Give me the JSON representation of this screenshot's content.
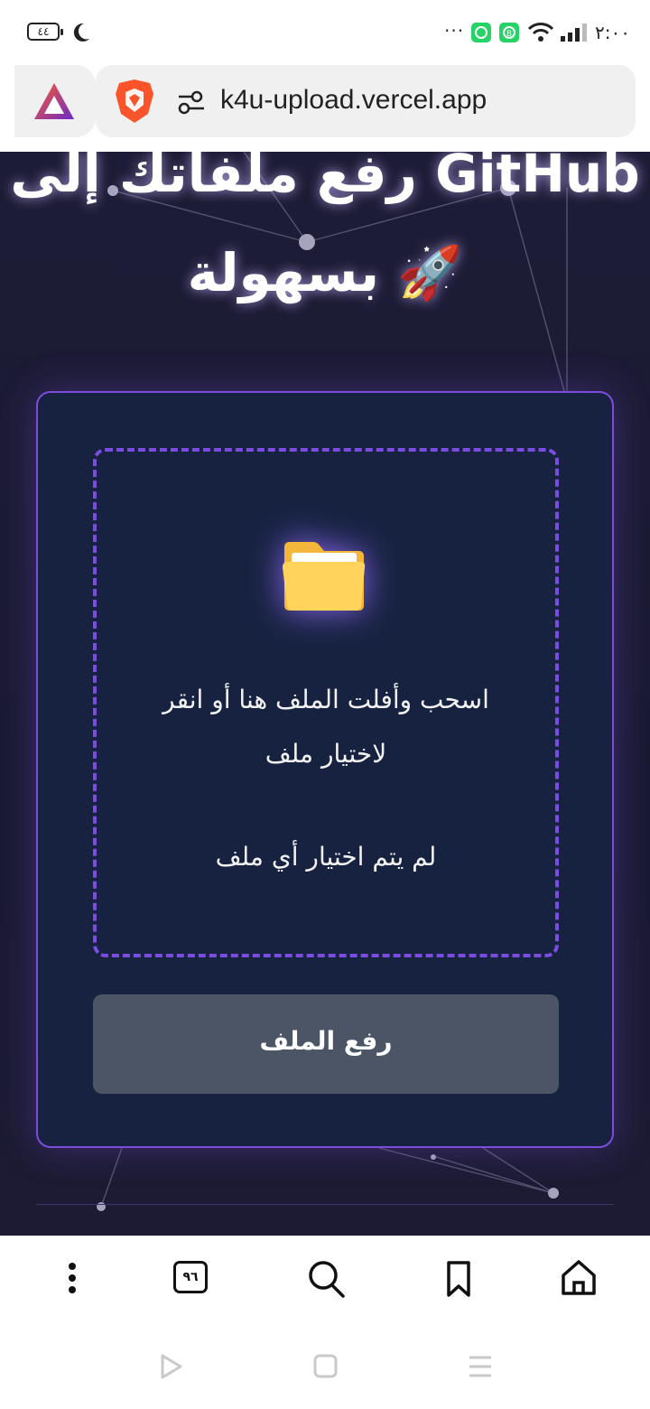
{
  "status_bar": {
    "time": "٢:٠٠",
    "battery": "٤٤",
    "overflow": "···",
    "icons": [
      "moon-icon",
      "whatsapp-icon",
      "whatsapp-business-icon",
      "wifi-icon",
      "signal-icon"
    ]
  },
  "browser": {
    "url": "k4u-upload.vercel.app",
    "tab_count": "٩٦",
    "icons": [
      "brave-rewards-icon",
      "brave-shield-icon",
      "site-settings-icon",
      "menu-icon",
      "search-icon",
      "bookmark-icon",
      "home-icon"
    ]
  },
  "page": {
    "title_line_1": "رفع ملفاتك إلى GitHub",
    "title_line_2": "بسهولة 🚀",
    "dropzone": {
      "icon": "📁",
      "instruction_line_1": "اسحب وأفلت الملف هنا أو انقر",
      "instruction_line_2": "لاختيار ملف",
      "status": "لم يتم اختيار أي ملف"
    },
    "upload_button": "رفع الملف"
  },
  "colors": {
    "page_bg": "#1d1c36",
    "card_bg": "#172241",
    "accent": "#7c4ddb",
    "button_bg": "#4b5565"
  }
}
